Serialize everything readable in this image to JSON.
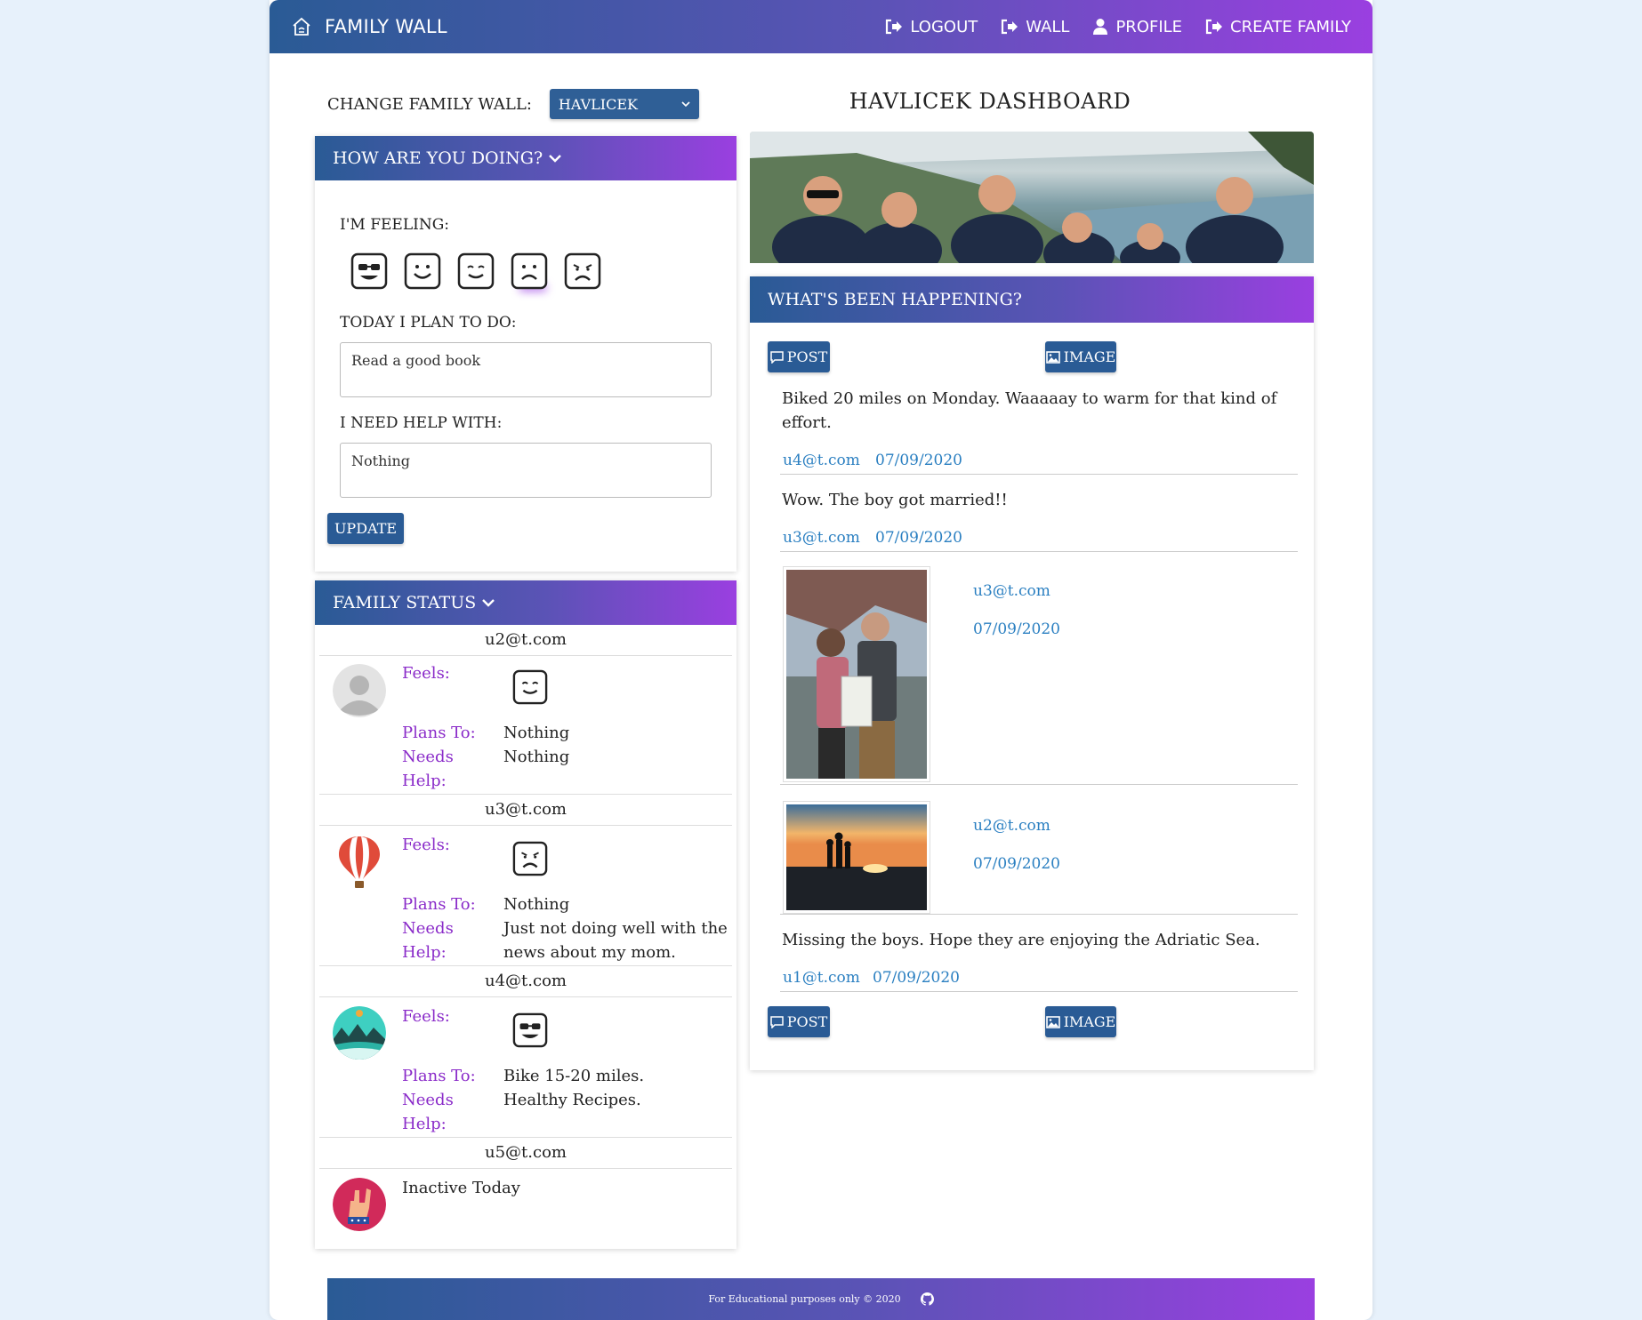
{
  "nav": {
    "brand": "FAMILY WALL",
    "links": [
      {
        "label": "LOGOUT",
        "icon": "logout-icon"
      },
      {
        "label": "WALL",
        "icon": "wall-icon"
      },
      {
        "label": "PROFILE",
        "icon": "user-icon"
      },
      {
        "label": "CREATE FAMILY",
        "icon": "create-family-icon"
      }
    ]
  },
  "change_wall": {
    "label": "CHANGE FAMILY WALL:",
    "selected": "HAVLICEK"
  },
  "dashboard_title": "HAVLICEK DASHBOARD",
  "how": {
    "header": "HOW ARE YOU DOING?",
    "feeling_label": "I'M FEELING:",
    "plan_label": "TODAY I PLAN TO DO:",
    "plan_value": "Read a good book",
    "help_label": "I NEED HELP WITH:",
    "help_value": "Nothing",
    "update_label": "UPDATE"
  },
  "status": {
    "header": "FAMILY STATUS",
    "feels_label": "Feels:",
    "plans_label": "Plans To:",
    "needs_label": "Needs",
    "help_label": "Help:",
    "members": [
      {
        "email": "u2@t.com",
        "plans": "Nothing",
        "needs": "Nothing"
      },
      {
        "email": "u3@t.com",
        "plans": "Nothing",
        "needs_1": "Just not doing well with the",
        "needs_2": "news about my mom."
      },
      {
        "email": "u4@t.com",
        "plans": "Bike 15-20 miles.",
        "needs": "Healthy Recipes."
      },
      {
        "email": "u5@t.com",
        "inactive": "Inactive Today"
      }
    ]
  },
  "happening": {
    "header": "WHAT'S BEEN HAPPENING?",
    "post_label": "POST",
    "image_label": "IMAGE",
    "posts": [
      {
        "text_1": "Biked 20 miles on Monday. Waaaaay to warm for that kind of",
        "text_2": "effort.",
        "author": "u4@t.com",
        "date": "07/09/2020"
      },
      {
        "text": "Wow. The boy got married!!",
        "author": "u3@t.com",
        "date": "07/09/2020"
      },
      {
        "author": "u3@t.com",
        "date": "07/09/2020"
      },
      {
        "author": "u2@t.com",
        "date": "07/09/2020"
      },
      {
        "text": "Missing the boys. Hope they are enjoying the Adriatic Sea.",
        "author": "u1@t.com",
        "date": "07/09/2020"
      }
    ]
  },
  "footer": {
    "text": "For Educational purposes only © 2020"
  }
}
